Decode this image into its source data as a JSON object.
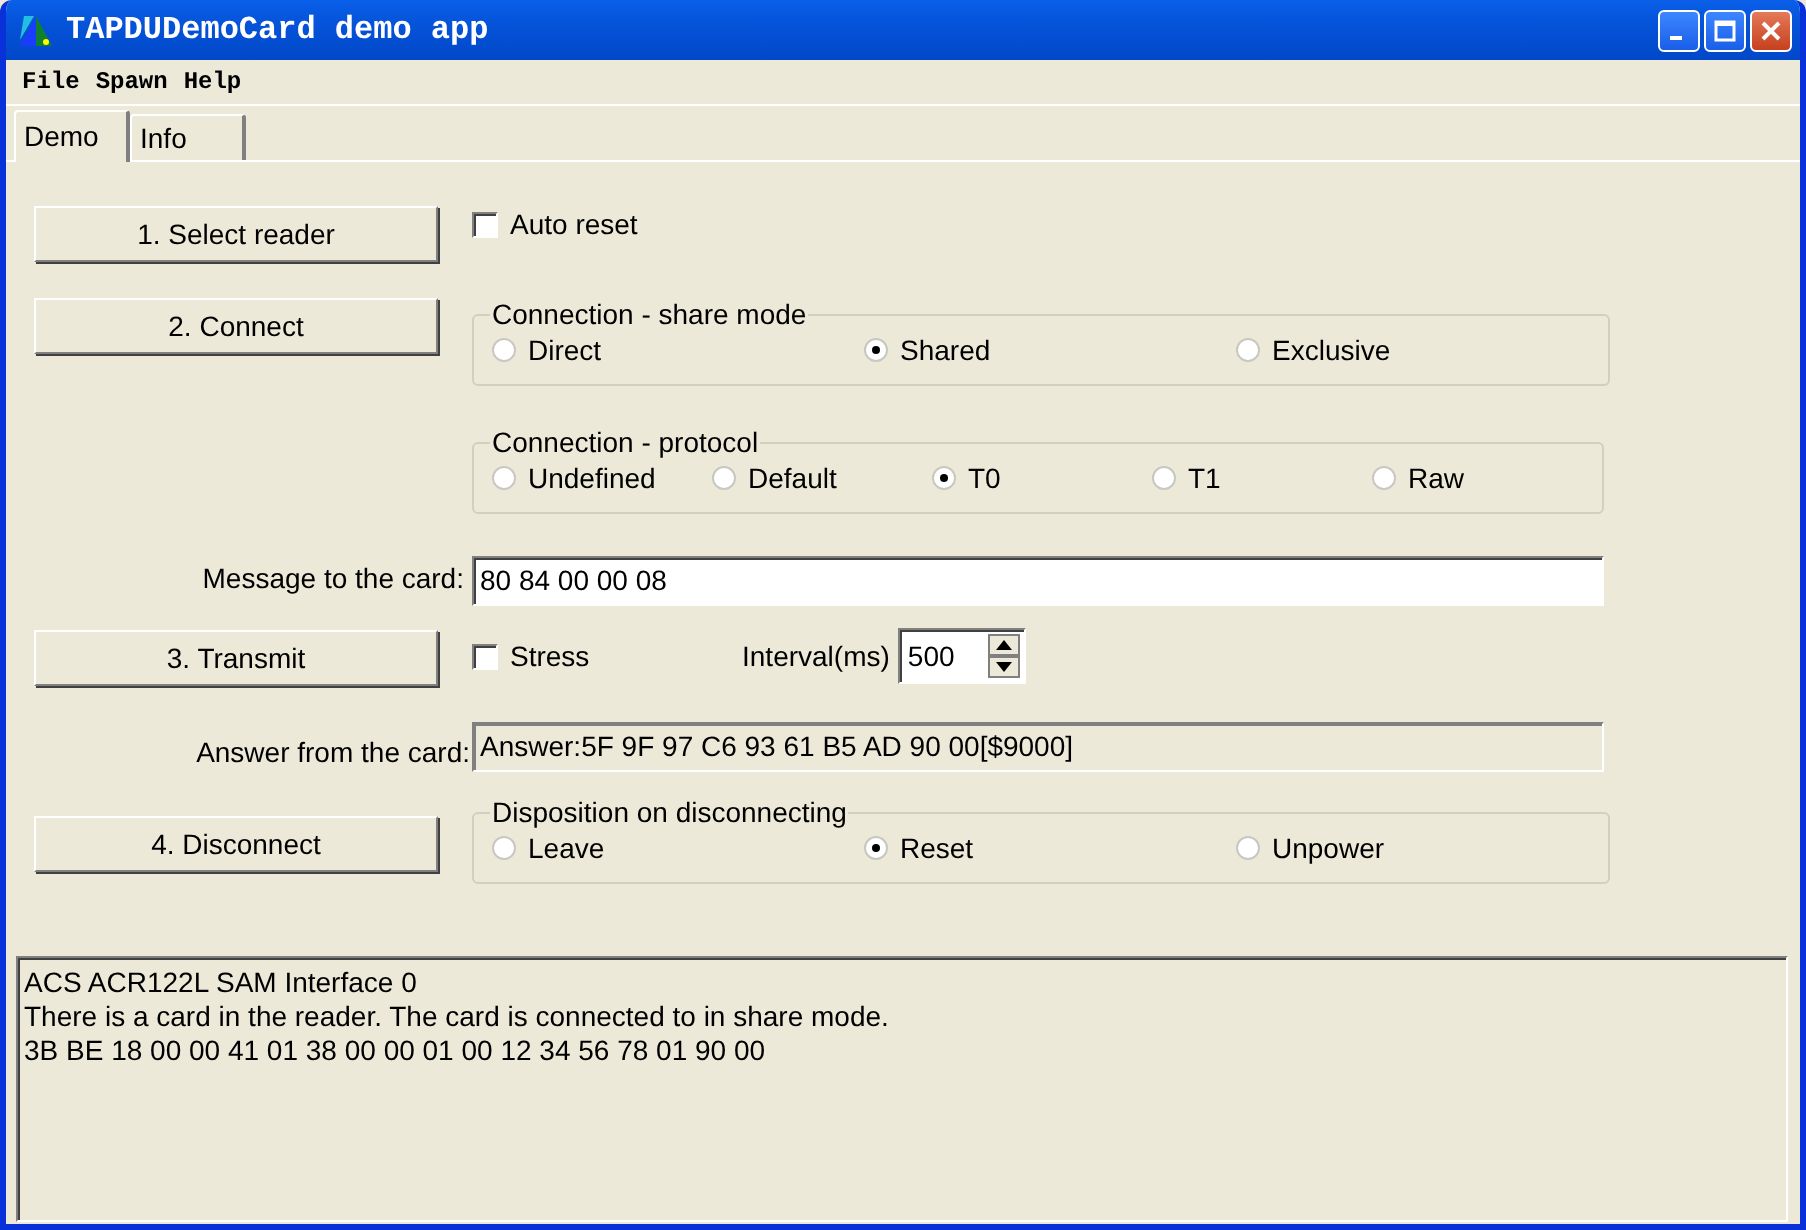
{
  "window": {
    "title": "TAPDUDemoCard demo app"
  },
  "menu": [
    "File",
    "Spawn",
    "Help"
  ],
  "tabs": [
    {
      "label": "Demo",
      "selected": true
    },
    {
      "label": "Info",
      "selected": false
    }
  ],
  "select_reader_button": "1. Select reader",
  "auto_reset": {
    "label": "Auto reset",
    "checked": false
  },
  "connect_button": "2. Connect",
  "share_mode": {
    "title": "Connection - share mode",
    "options": [
      {
        "label": "Direct",
        "selected": false
      },
      {
        "label": "Shared",
        "selected": true
      },
      {
        "label": "Exclusive",
        "selected": false
      }
    ]
  },
  "protocol": {
    "title": "Connection - protocol",
    "options": [
      {
        "label": "Undefined",
        "selected": false
      },
      {
        "label": "Default",
        "selected": false
      },
      {
        "label": "T0",
        "selected": true
      },
      {
        "label": "T1",
        "selected": false
      },
      {
        "label": "Raw",
        "selected": false
      }
    ]
  },
  "message": {
    "label": "Message to the card:",
    "value": "80 84 00 00 08"
  },
  "transmit_button": "3. Transmit",
  "stress": {
    "label": "Stress",
    "checked": false
  },
  "interval": {
    "label": "Interval(ms)",
    "value": "500"
  },
  "answer": {
    "label": "Answer from the card:",
    "value": "Answer:5F 9F 97 C6 93 61 B5 AD 90 00[$9000]"
  },
  "disconnect_button": "4. Disconnect",
  "disposition": {
    "title": "Disposition on disconnecting",
    "options": [
      {
        "label": "Leave",
        "selected": false
      },
      {
        "label": "Reset",
        "selected": true
      },
      {
        "label": "Unpower",
        "selected": false
      }
    ]
  },
  "log": [
    "ACS ACR122L SAM Interface 0",
    "There is a card in the reader. The card is connected to in share mode.",
    "3B BE 18 00 00 41 01 38 00 00 01 00 12 34 56 78 01 90 00"
  ]
}
